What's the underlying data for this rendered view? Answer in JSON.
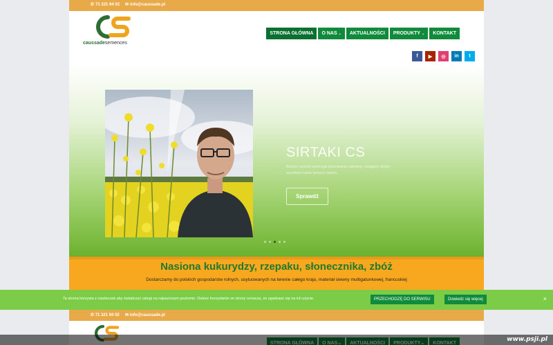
{
  "topbar": {
    "phone": "71 321 94 02",
    "email": "info@caussade.pl"
  },
  "logo": {
    "brand_bold": "caussade",
    "brand_light": "semences"
  },
  "nav": [
    {
      "label": "STRONA GŁÓWNA",
      "has_dropdown": false,
      "active": true
    },
    {
      "label": "O NAS",
      "has_dropdown": true,
      "active": false
    },
    {
      "label": "AKTUALNOŚCI",
      "has_dropdown": false,
      "active": false
    },
    {
      "label": "PRODUKTY",
      "has_dropdown": true,
      "active": false
    },
    {
      "label": "KONTAKT",
      "has_dropdown": false,
      "active": false
    }
  ],
  "social": [
    {
      "label": "f",
      "icon": "facebook-icon",
      "color": "#3b5998"
    },
    {
      "label": "▶",
      "icon": "youtube-icon",
      "color": "#a82400"
    },
    {
      "label": "◎",
      "icon": "instagram-icon",
      "color": "#e33e72"
    },
    {
      "label": "in",
      "icon": "linkedin-icon",
      "color": "#007bb6"
    },
    {
      "label": "t",
      "icon": "twitter-icon",
      "color": "#00aced"
    }
  ],
  "slider": {
    "title": "SIRTAKI CS",
    "text": "Bardzo wysoki potencjał plonowania odmiany osiągany dzięki wysokiej masie tysiąca nasion.",
    "button": "Sprawdź",
    "dot_count": 5,
    "active_dot": 3
  },
  "band": {
    "heading": "Nasiona kukurydzy, rzepaku, słonecznika, zbóż",
    "text": "Dostarczamy do polskich gospodarstw rolnych, usytuowanych na terenie całego kraju, materiał siewny multigatunkowej, francuskiej"
  },
  "cookie": {
    "message": "Ta strona korzysta z ciasteczek aby świadczyć usługi na najwyższym poziomie. Dalsze korzystanie ze strony oznacza, że zgadzasz się na ich użycie.",
    "accept": "PRZECHODZĘ DO SERWISU",
    "more": "Dowiedz się więcej",
    "close": "×"
  },
  "watermark": "www.psji.pl",
  "colors": {
    "topbar": "#e8a948",
    "nav_green": "#108a3b",
    "band_orange": "#f7a81f",
    "heading_green": "#1f7a2f",
    "cookie_green": "#7dcc47"
  }
}
